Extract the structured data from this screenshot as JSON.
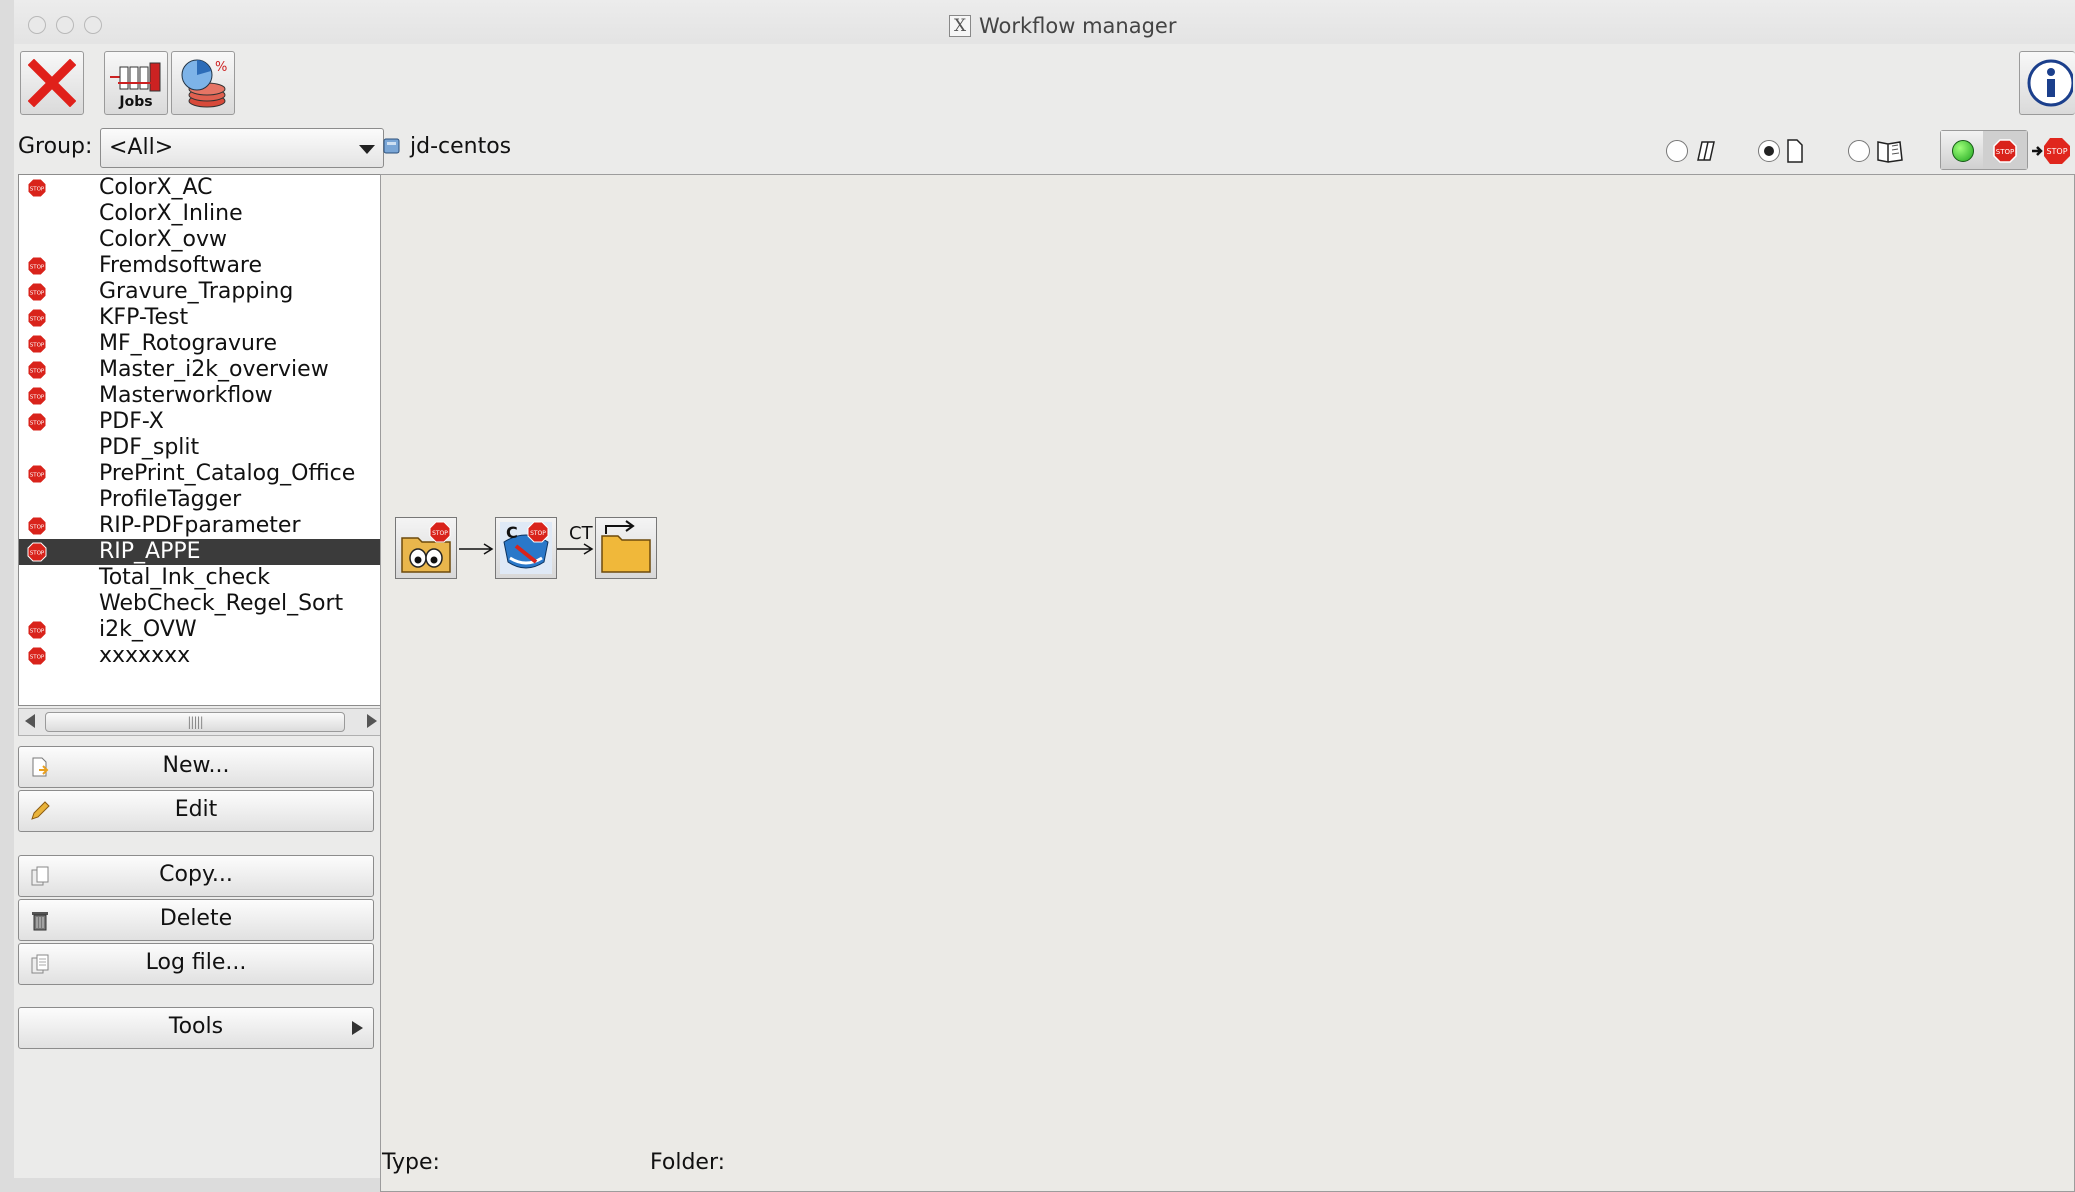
{
  "window": {
    "title": "Workflow manager"
  },
  "toolbar": {
    "close_icon": "red-x-icon",
    "jobs_label": "Jobs",
    "stats_icon": "pie-chart-disk-icon",
    "info_icon": "info-icon"
  },
  "group": {
    "label": "Group:",
    "value": "<All>"
  },
  "workflows": [
    {
      "name": "ColorX_AC",
      "stopped": true
    },
    {
      "name": "ColorX_Inline",
      "stopped": false
    },
    {
      "name": "ColorX_ovw",
      "stopped": false
    },
    {
      "name": "Fremdsoftware",
      "stopped": true
    },
    {
      "name": "Gravure_Trapping",
      "stopped": true
    },
    {
      "name": "KFP-Test",
      "stopped": true
    },
    {
      "name": "MF_Rotogravure",
      "stopped": true
    },
    {
      "name": "Master_i2k_overview",
      "stopped": true
    },
    {
      "name": "Masterworkflow",
      "stopped": true
    },
    {
      "name": "PDF-X",
      "stopped": true
    },
    {
      "name": "PDF_split",
      "stopped": false
    },
    {
      "name": "PrePrint_Catalog_Office",
      "stopped": true
    },
    {
      "name": "ProfileTagger",
      "stopped": false
    },
    {
      "name": "RIP-PDFparameter",
      "stopped": true
    },
    {
      "name": "RIP_APPE",
      "stopped": true,
      "selected": true
    },
    {
      "name": "Total_Ink_check",
      "stopped": false
    },
    {
      "name": "WebCheck_Regel_Sort",
      "stopped": false
    },
    {
      "name": "i2k_OVW",
      "stopped": true
    },
    {
      "name": "xxxxxxx",
      "stopped": true
    }
  ],
  "stop_icon_text": "STOP",
  "buttons": {
    "new": "New...",
    "edit": "Edit",
    "copy": "Copy...",
    "delete": "Delete",
    "log": "Log file...",
    "tools": "Tools"
  },
  "server": {
    "name": "jd-centos"
  },
  "view_modes": [
    "multi-page-icon",
    "single-page-icon",
    "book-icon"
  ],
  "view_selected": 1,
  "status_controls": [
    "green-light-icon",
    "stop-sign-icon",
    "arrow-to-stop-icon"
  ],
  "workflow_nodes": [
    {
      "icon": "hotfolder-eyes-icon",
      "stopped": true,
      "badge": ""
    },
    {
      "icon": "color-server-icon",
      "stopped": true,
      "badge": "C"
    },
    {
      "icon": "output-folder-icon",
      "stopped": false,
      "badge": ""
    }
  ],
  "connector_label": "CT",
  "statusbar": {
    "type_label": "Type:",
    "folder_label": "Folder:"
  }
}
